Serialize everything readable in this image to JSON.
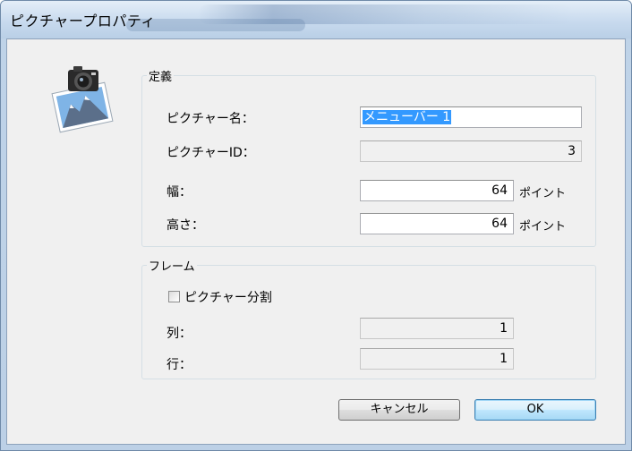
{
  "window": {
    "title": "ピクチャープロパティ"
  },
  "definition": {
    "group_title": "定義",
    "picture_name_label": "ピクチャー名：",
    "picture_name_value": "メニューバー 1",
    "picture_id_label": "ピクチャーID：",
    "picture_id_value": "3",
    "width_label": "幅：",
    "width_value": "64",
    "width_unit": "ポイント",
    "height_label": "高さ：",
    "height_value": "64",
    "height_unit": "ポイント"
  },
  "frame": {
    "group_title": "フレーム",
    "split_checkbox_label": "ピクチャー分割",
    "split_checked": false,
    "columns_label": "列：",
    "columns_value": "1",
    "rows_label": "行：",
    "rows_value": "1"
  },
  "buttons": {
    "cancel": "キャンセル",
    "ok": "OK"
  },
  "icons": {
    "picture_icon": "camera-photo-icon"
  }
}
